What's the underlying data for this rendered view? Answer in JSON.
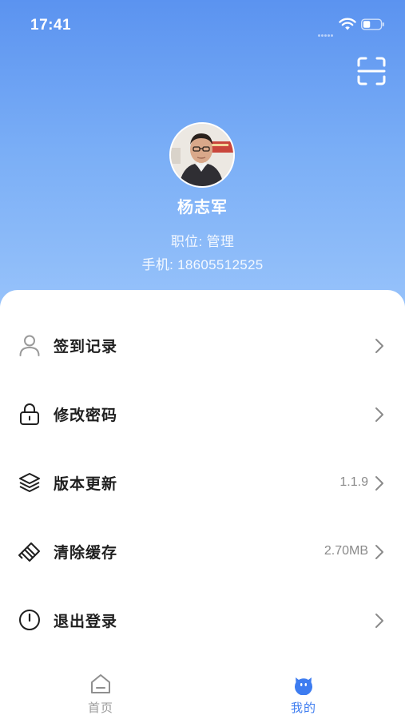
{
  "status_bar": {
    "time": "17:41"
  },
  "profile": {
    "name": "杨志军",
    "position": "职位: 管理",
    "phone": "手机: 18605512525"
  },
  "menu": [
    {
      "label": "签到记录",
      "value": "",
      "icon": "user-icon"
    },
    {
      "label": "修改密码",
      "value": "",
      "icon": "lock-icon"
    },
    {
      "label": "版本更新",
      "value": "1.1.9",
      "icon": "layers-icon"
    },
    {
      "label": "清除缓存",
      "value": "2.70MB",
      "icon": "eraser-icon"
    },
    {
      "label": "退出登录",
      "value": "",
      "icon": "power-icon"
    }
  ],
  "tabbar": {
    "home_label": "首页",
    "mine_label": "我的",
    "active": "mine"
  },
  "colors": {
    "accent": "#3d7cf0",
    "header_top": "#5b93f0",
    "header_bottom": "#9cc6fb"
  }
}
